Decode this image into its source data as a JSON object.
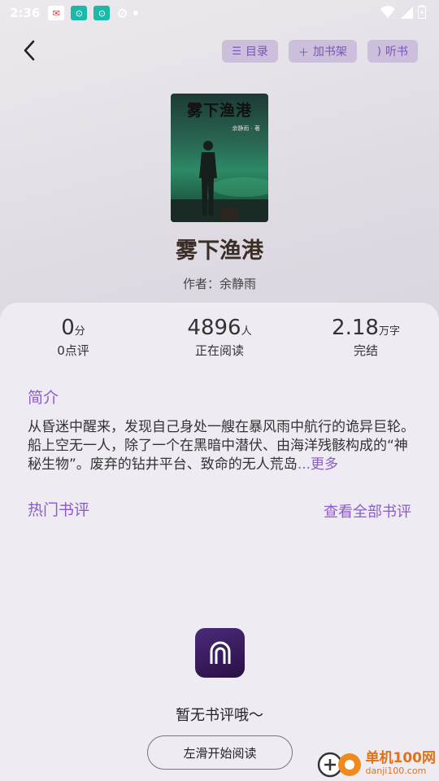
{
  "status_bar": {
    "time": "2:36"
  },
  "toolbar": {
    "toc_label": "目录",
    "add_shelf_label": "加书架",
    "listen_label": "听书"
  },
  "book": {
    "cover_title": "雾下渔港",
    "cover_author": "余静雨 · 著",
    "title": "雾下渔港",
    "author_line": "作者：余静雨"
  },
  "stats": [
    {
      "value": "0",
      "unit": "分",
      "label": "0点评"
    },
    {
      "value": "4896",
      "unit": "人",
      "label": "正在阅读"
    },
    {
      "value": "2.18",
      "unit": "万字",
      "label": "完结"
    }
  ],
  "intro": {
    "heading": "简介",
    "text": "从昏迷中醒来，发现自己身处一艘在暴风雨中航行的诡异巨轮。船上空无一人，除了一个在黑暗中潜伏、由海洋残骸构成的“神秘生物”。废弃的钻井平台、致命的无人荒岛",
    "more": "...更多"
  },
  "reviews": {
    "heading": "热门书评",
    "view_all": "查看全部书评",
    "empty_text": "暂无书评哦～",
    "start_button": "左滑开始阅读"
  },
  "watermark": {
    "main": "单机100网",
    "sub": "danji100.com"
  }
}
